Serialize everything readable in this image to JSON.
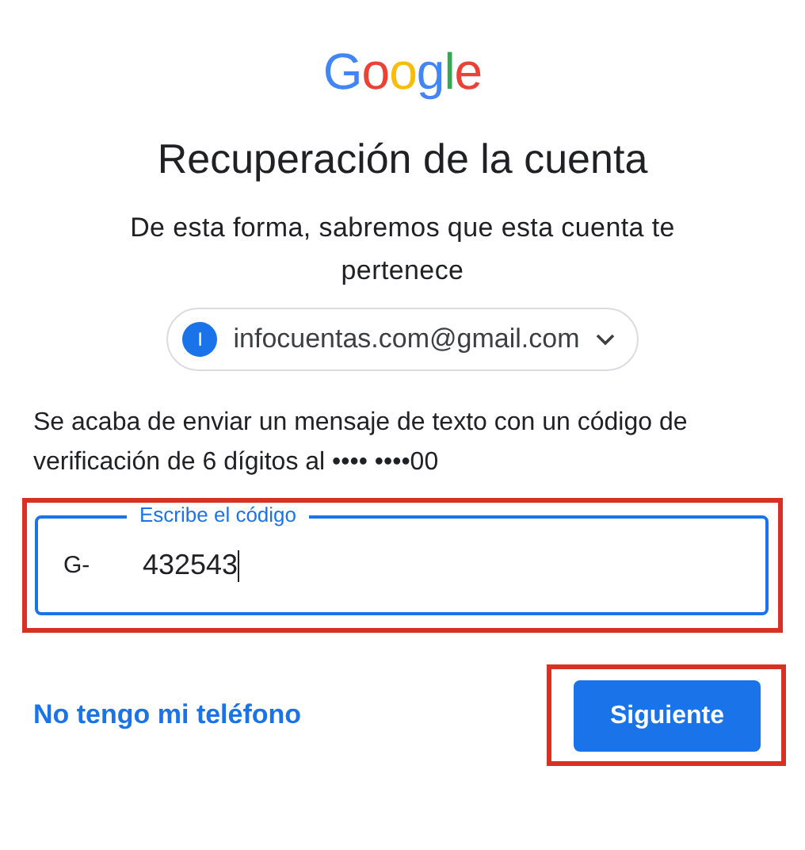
{
  "logo": "Google",
  "title": "Recuperación de la cuenta",
  "subtitle": "De esta forma, sabremos que esta cuenta te pertenece",
  "account": {
    "initial": "I",
    "email": "infocuentas.com@gmail.com"
  },
  "message": "Se acaba de enviar un mensaje de texto con un código de verificación de 6 dígitos al •••• ••••00",
  "code_field": {
    "label": "Escribe el código",
    "prefix": "G-",
    "value": "432543",
    "focused": true
  },
  "link": "No tengo mi teléfono",
  "button": "Siguiente"
}
